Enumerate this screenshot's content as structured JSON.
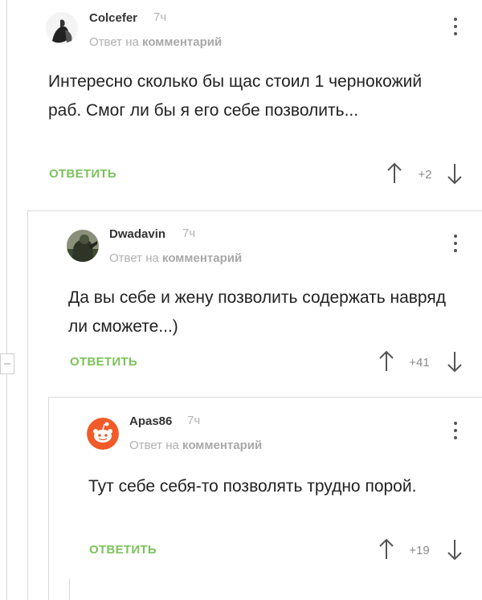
{
  "comments": [
    {
      "author": "Colcefer",
      "time": "7ч",
      "reply_prefix": "Ответ на",
      "reply_target": "комментарий",
      "text": "Интересно сколько бы щас стоил 1 чернокожий раб. Смог ли бы я его себе позволить...",
      "reply_label": "ОТВЕТИТЬ",
      "rating": "+2"
    },
    {
      "author": "Dwadavin",
      "time": "7ч",
      "reply_prefix": "Ответ на",
      "reply_target": "комментарий",
      "text": "Да вы себе и жену позволить содержать навряд ли сможете...)",
      "reply_label": "ОТВЕТИТЬ",
      "rating": "+41"
    },
    {
      "author": "Apas86",
      "time": "7ч",
      "reply_prefix": "Ответ на",
      "reply_target": "комментарий",
      "text": "Тут себе себя-то  позволять трудно порой.",
      "reply_label": "ОТВЕТИТЬ",
      "rating": "+19"
    }
  ],
  "colors": {
    "reply_button": "#7cc35a",
    "thread_line": "#d9d9d9",
    "reddit_avatar": "#f25a29"
  },
  "icons": [
    "upvote-arrow-icon",
    "downvote-arrow-icon",
    "more-options-icon",
    "collapse-thread-icon"
  ]
}
